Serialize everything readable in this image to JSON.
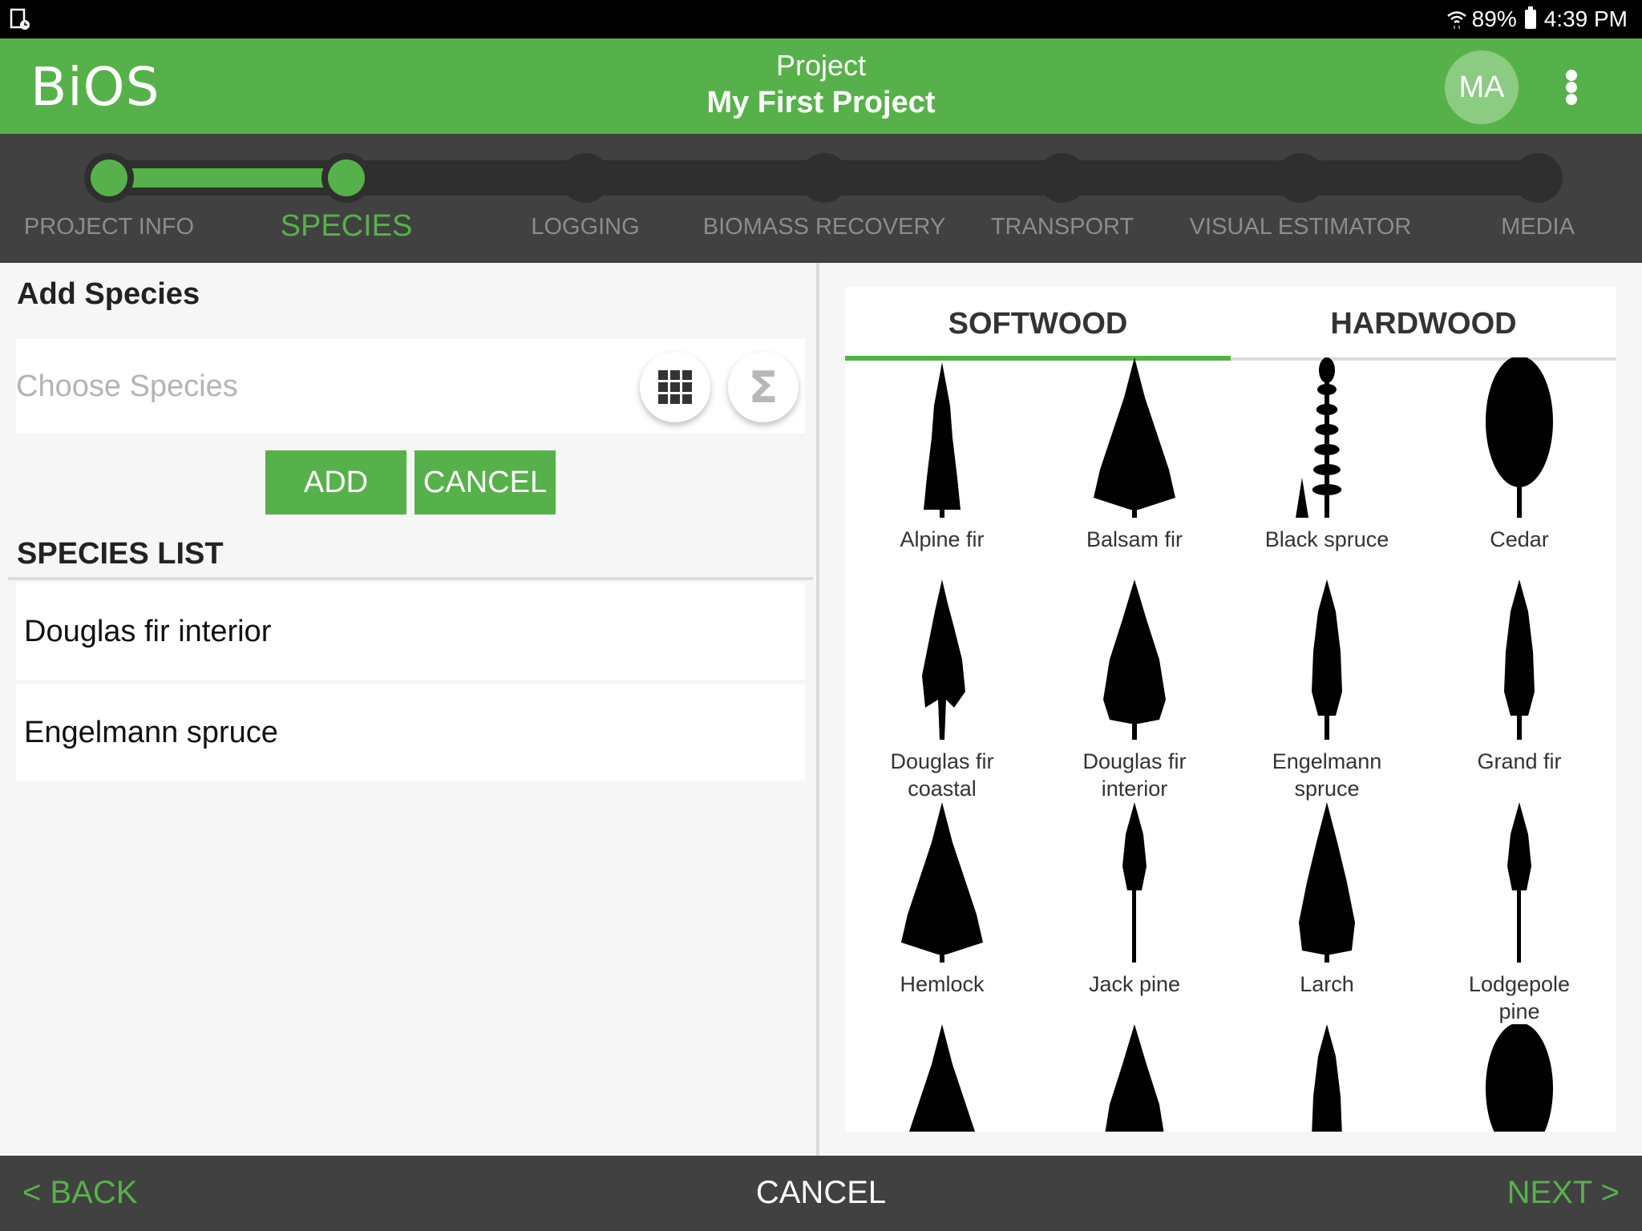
{
  "status_bar": {
    "left_icon": "screen-record-icon",
    "wifi_icon": "wifi-icon",
    "battery_percent": "89%",
    "battery_icon": "battery-icon",
    "time": "4:39 PM"
  },
  "header": {
    "logo": "BiOS",
    "subtitle": "Project",
    "title": "My First Project",
    "avatar_initials": "MA",
    "menu_icon": "more-vert-icon"
  },
  "stepper": {
    "current_step": 2,
    "total_steps": 7,
    "steps": [
      {
        "label": "PROJECT INFO",
        "state": "complete"
      },
      {
        "label": "SPECIES",
        "state": "active"
      },
      {
        "label": "LOGGING",
        "state": "pending"
      },
      {
        "label": "BIOMASS RECOVERY",
        "state": "pending"
      },
      {
        "label": "TRANSPORT",
        "state": "pending"
      },
      {
        "label": "VISUAL ESTIMATOR",
        "state": "pending"
      },
      {
        "label": "MEDIA",
        "state": "pending"
      }
    ]
  },
  "add_species": {
    "title": "Add Species",
    "input_value": "",
    "input_placeholder": "Choose Species",
    "grid_button_icon": "grid-icon",
    "sum_button_icon": "sigma-icon",
    "add_label": "ADD",
    "cancel_label": "CANCEL"
  },
  "species_list": {
    "title": "SPECIES LIST",
    "items": [
      "Douglas fir interior",
      "Engelmann spruce"
    ]
  },
  "picker": {
    "tabs": [
      {
        "label": "SOFTWOOD",
        "active": true
      },
      {
        "label": "HARDWOOD",
        "active": false
      }
    ],
    "trees": [
      {
        "label": "Alpine fir",
        "icon": "alpine-fir-tree-icon"
      },
      {
        "label": "Balsam fir",
        "icon": "balsam-fir-tree-icon"
      },
      {
        "label": "Black spruce",
        "icon": "black-spruce-tree-icon"
      },
      {
        "label": "Cedar",
        "icon": "cedar-tree-icon"
      },
      {
        "label": "Douglas fir\ncoastal",
        "icon": "douglas-fir-coastal-tree-icon"
      },
      {
        "label": "Douglas fir\ninterior",
        "icon": "douglas-fir-interior-tree-icon"
      },
      {
        "label": "Engelmann\nspruce",
        "icon": "engelmann-spruce-tree-icon"
      },
      {
        "label": "Grand fir",
        "icon": "grand-fir-tree-icon"
      },
      {
        "label": "Hemlock",
        "icon": "hemlock-tree-icon"
      },
      {
        "label": "Jack pine",
        "icon": "jack-pine-tree-icon"
      },
      {
        "label": "Larch",
        "icon": "larch-tree-icon"
      },
      {
        "label": "Lodgepole\npine",
        "icon": "lodgepole-pine-tree-icon"
      },
      {
        "label": "",
        "icon": "tree-icon"
      },
      {
        "label": "",
        "icon": "tree-icon"
      },
      {
        "label": "",
        "icon": "tree-icon"
      },
      {
        "label": "",
        "icon": "tree-icon"
      }
    ]
  },
  "bottom_bar": {
    "back_label": "< BACK",
    "cancel_label": "CANCEL",
    "next_label": "NEXT >"
  },
  "colors": {
    "brand_green": "#57b14a",
    "dark_bar": "#414141",
    "track": "#2f2f2f",
    "inactive_step_text": "#8c8c8c"
  }
}
